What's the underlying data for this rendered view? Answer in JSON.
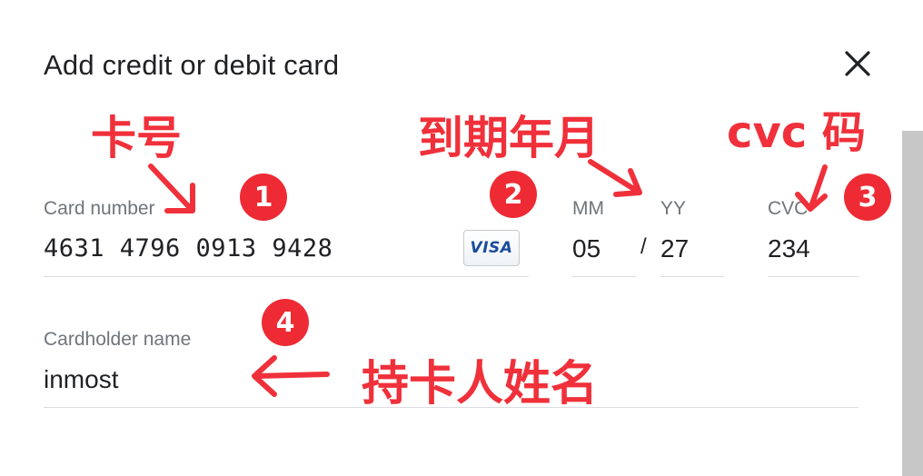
{
  "dialog": {
    "title": "Add credit or debit card",
    "close_icon": "close-icon"
  },
  "card_number": {
    "label": "Card number",
    "value": "4631 4796 0913 9428",
    "brand_logo": "VISA"
  },
  "expiry": {
    "month_label": "MM",
    "month_value": "05",
    "separator": "/",
    "year_label": "YY",
    "year_value": "27"
  },
  "cvc": {
    "label": "CVC",
    "value": "234"
  },
  "cardholder": {
    "label": "Cardholder name",
    "value": "inmost"
  },
  "annotations": {
    "card_number_note": "卡号",
    "expiry_note": "到期年月",
    "cvc_note": "cvc 码",
    "cardholder_note": "持卡人姓名",
    "badges": [
      "1",
      "2",
      "3",
      "4"
    ],
    "color": "#f0303a"
  }
}
